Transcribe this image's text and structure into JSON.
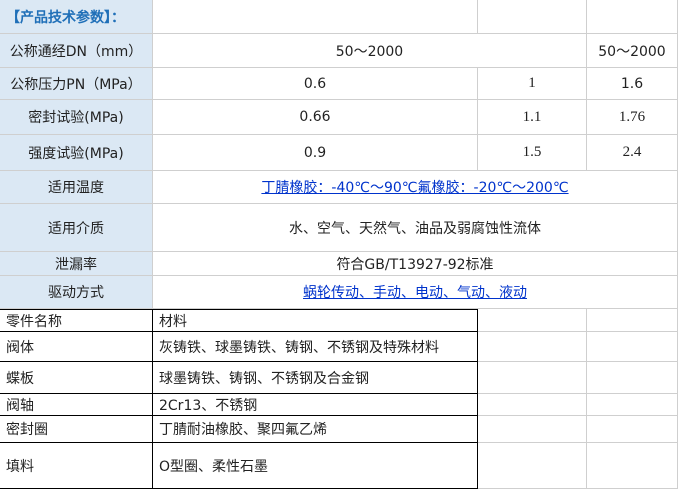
{
  "title": "【产品技术参数】：",
  "spec_rows": [
    {
      "label": "公称通经DN（mm）",
      "v1": "50～2000",
      "v3": "50～2000"
    },
    {
      "label": "公称压力PN（MPa）",
      "v1": "0.6",
      "v2": "1",
      "v3": "1.6"
    },
    {
      "label": "密封试验(MPa)",
      "v1": "0.66",
      "v2": "1.1",
      "v3": "1.76"
    },
    {
      "label": "强度试验(MPa)",
      "v1": "0.9",
      "v2": "1.5",
      "v3": "2.4"
    }
  ],
  "info_rows": [
    {
      "label": "适用温度",
      "value": "丁腈橡胶：-40℃～90℃氟橡胶：-20℃～200℃"
    },
    {
      "label": "适用介质",
      "value": "水、空气、天然气、油品及弱腐蚀性流体"
    },
    {
      "label": "泄漏率",
      "value": "符合GB/T13927-92标准"
    },
    {
      "label": "驱动方式",
      "value": "蜗轮传动、手动、电动、气动、液动"
    }
  ],
  "parts_header": {
    "name": "零件名称",
    "material": "材料"
  },
  "parts": [
    {
      "name": "阀体",
      "material": "灰铸铁、球墨铸铁、铸钢、不锈钢及特殊材料"
    },
    {
      "name": "蝶板",
      "material": "球墨铸铁、铸钢、不锈钢及合金钢"
    },
    {
      "name": "阀轴",
      "material": "2Cr13、不锈钢"
    },
    {
      "name": "密封圈",
      "material": "丁腈耐油橡胶、聚四氟乙烯"
    },
    {
      "name": "填料",
      "material": "O型圈、柔性石墨"
    }
  ]
}
